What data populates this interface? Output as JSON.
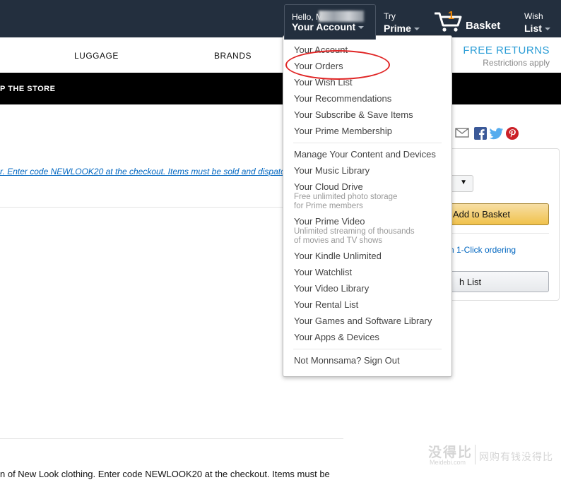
{
  "header": {
    "greeting": "Hello, M",
    "account_label": "Your Account",
    "prime_small": "Try",
    "prime_big": "Prime",
    "basket_count": "1",
    "basket_label": "Basket",
    "wish_small": "Wish",
    "wish_big": "List"
  },
  "store_nav": {
    "luggage": "LUGGAGE",
    "brands": "BRANDS",
    "free_returns": "FREE RETURNS",
    "restrictions": "Restrictions apply",
    "shop_store": "P THE STORE"
  },
  "content": {
    "promo_link": "r. Enter code NEWLOOK20 at the checkout. Items must be sold and dispatc",
    "bottom_text": "n of New Look clothing. Enter code NEWLOOK20 at the checkout. Items must be"
  },
  "buybox": {
    "add_to_basket": "Add to Basket",
    "one_click": "n 1-Click ordering",
    "wish_list": "h List",
    "qty_caret": "▼"
  },
  "dropdown": {
    "group1": [
      "Your Account",
      "Your Orders",
      "Your Wish List",
      "Your Recommendations",
      "Your Subscribe & Save Items",
      "Your Prime Membership"
    ],
    "group2": [
      "Manage Your Content and Devices",
      "Your Music Library",
      "Your Cloud Drive"
    ],
    "cloud_sub1": "Free unlimited photo storage",
    "cloud_sub2": "for Prime members",
    "prime_video": "Your Prime Video",
    "video_sub1": "Unlimited streaming of thousands",
    "video_sub2": "of movies and TV shows",
    "group3": [
      "Your Kindle Unlimited",
      "Your Watchlist",
      "Your Video Library",
      "Your Rental List",
      "Your Games and Software Library",
      "Your Apps & Devices"
    ],
    "sign_out": "Not Monnsama? Sign Out"
  },
  "watermark": {
    "main": "没得比",
    "url": "Meidebi.com",
    "slogan": "网购有钱没得比"
  },
  "colors": {
    "topbar": "#232f3e",
    "accent_orange": "#f08804",
    "link_blue": "#0066c0",
    "free_returns_blue": "#2b9dd6",
    "button_gold": "#f0c14b",
    "annotation_red": "#e02424"
  },
  "icons": [
    "cart-icon",
    "caret-down-icon",
    "email-icon",
    "facebook-icon",
    "twitter-icon",
    "pinterest-icon"
  ]
}
